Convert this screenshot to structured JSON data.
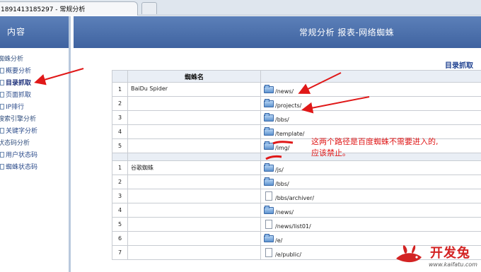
{
  "browser": {
    "tab_title": "1891413185297 - 常规分析"
  },
  "sidebar": {
    "header": "内容",
    "items": [
      {
        "label": "蜘蛛分析",
        "kind": "group"
      },
      {
        "label": "概要分析",
        "kind": "sub"
      },
      {
        "label": "目录抓取",
        "kind": "sub",
        "active": true
      },
      {
        "label": "页面抓取",
        "kind": "sub"
      },
      {
        "label": "IP排行",
        "kind": "sub"
      },
      {
        "label": "搜索引擎分析",
        "kind": "group"
      },
      {
        "label": "关键字分析",
        "kind": "sub"
      },
      {
        "label": "状态码分析",
        "kind": "group"
      },
      {
        "label": "用户状态码",
        "kind": "sub"
      },
      {
        "label": "蜘蛛状态码",
        "kind": "sub"
      }
    ]
  },
  "main": {
    "title": "常规分析  报表-网络蜘蛛",
    "dir_link": "目录抓取",
    "table": {
      "col_header": "蜘蛛名",
      "groups": [
        {
          "spider": "BaiDu Spider",
          "rows": [
            {
              "num": "1",
              "icon": "folder-icon",
              "path": "/news/"
            },
            {
              "num": "2",
              "icon": "folder-icon",
              "path": "/projects/"
            },
            {
              "num": "3",
              "icon": "folder-icon",
              "path": "/bbs/"
            },
            {
              "num": "4",
              "icon": "folder-icon",
              "path": "/template/"
            },
            {
              "num": "5",
              "icon": "folder-icon",
              "path": "/img/"
            }
          ]
        },
        {
          "spider": "谷歌蜘蛛",
          "rows": [
            {
              "num": "1",
              "icon": "folder-icon",
              "path": "/js/"
            },
            {
              "num": "2",
              "icon": "folder-icon",
              "path": "/bbs/"
            },
            {
              "num": "3",
              "icon": "file-icon",
              "path": "/bbs/archiver/"
            },
            {
              "num": "4",
              "icon": "folder-icon",
              "path": "/news/"
            },
            {
              "num": "5",
              "icon": "file-icon",
              "path": "/news/list01/"
            },
            {
              "num": "6",
              "icon": "folder-icon",
              "path": "/e/"
            },
            {
              "num": "7",
              "icon": "file-icon",
              "path": "/e/public/"
            }
          ]
        }
      ]
    }
  },
  "annotation": {
    "line1": "这两个路径是百度蜘蛛不需要进入的,",
    "line2": "应该禁止。",
    "color": "#e01818"
  },
  "watermark": {
    "text": "开发兔",
    "url": "www.kaifatu.com",
    "color": "#d32323"
  }
}
